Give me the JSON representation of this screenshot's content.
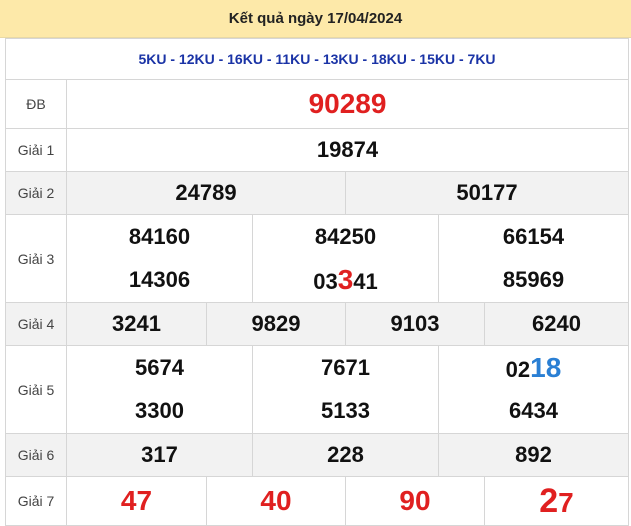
{
  "header": {
    "title": "Kết quả ngày 17/04/2024"
  },
  "codes": "5KU - 12KU - 16KU - 11KU - 13KU - 18KU - 15KU - 7KU",
  "prizes": {
    "db": {
      "label": "ĐB",
      "value": "90289"
    },
    "g1": {
      "label": "Giải 1",
      "value": "19874"
    },
    "g2": {
      "label": "Giải 2",
      "values": [
        "24789",
        "50177"
      ]
    },
    "g3": {
      "label": "Giải 3",
      "values": [
        "84160",
        "84250",
        "66154",
        "14306",
        "85969"
      ],
      "v5": {
        "prefix": "03",
        "highlight": "3",
        "suffix": "41"
      }
    },
    "g4": {
      "label": "Giải 4",
      "values": [
        "3241",
        "9829",
        "9103",
        "6240"
      ]
    },
    "g5": {
      "label": "Giải 5",
      "values": [
        "5674",
        "7671",
        "3300",
        "5133",
        "6434"
      ],
      "v3": {
        "prefix": "02",
        "highlight": "18"
      }
    },
    "g6": {
      "label": "Giải 6",
      "values": [
        "317",
        "228",
        "892"
      ]
    },
    "g7": {
      "label": "Giải 7",
      "values": [
        "47",
        "40",
        "90"
      ],
      "v4": {
        "highlight": "2",
        "suffix": "7"
      }
    }
  }
}
